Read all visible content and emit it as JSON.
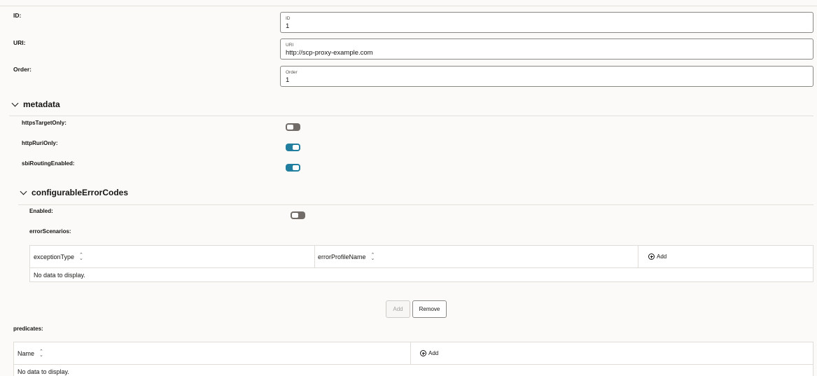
{
  "fields": {
    "id": {
      "label": "ID:",
      "float_label": "ID",
      "value": "1"
    },
    "uri": {
      "label": "URI:",
      "float_label": "URI",
      "value": "http://scp-proxy-example.com"
    },
    "order": {
      "label": "Order:",
      "float_label": "Order",
      "value": "1"
    }
  },
  "metadata": {
    "title": "metadata",
    "https_target_only": {
      "label": "httpsTargetOnly:",
      "checked": false
    },
    "http_ruri_only": {
      "label": "httpRuriOnly:",
      "checked": true
    },
    "sbi_routing_enabled": {
      "label": "sbiRoutingEnabled:",
      "checked": true
    }
  },
  "configurable_error_codes": {
    "title": "configurableErrorCodes",
    "enabled": {
      "label": "Enabled:",
      "checked": false
    },
    "error_scenarios_label": "errorScenarios:",
    "table": {
      "columns": [
        "exceptionType",
        "errorProfileName"
      ],
      "add_label": "Add",
      "empty_text": "No data to display."
    },
    "add_button": "Add",
    "remove_button": "Remove"
  },
  "predicates": {
    "label": "predicates:",
    "table": {
      "columns": [
        "Name"
      ],
      "add_label": "Add",
      "empty_text": "No data to display."
    }
  },
  "colors": {
    "toggle_on": "#227e9e",
    "toggle_off": "#716c68"
  },
  "icons": [
    "chevron-down-icon",
    "sort-icon",
    "add-circle-icon"
  ]
}
